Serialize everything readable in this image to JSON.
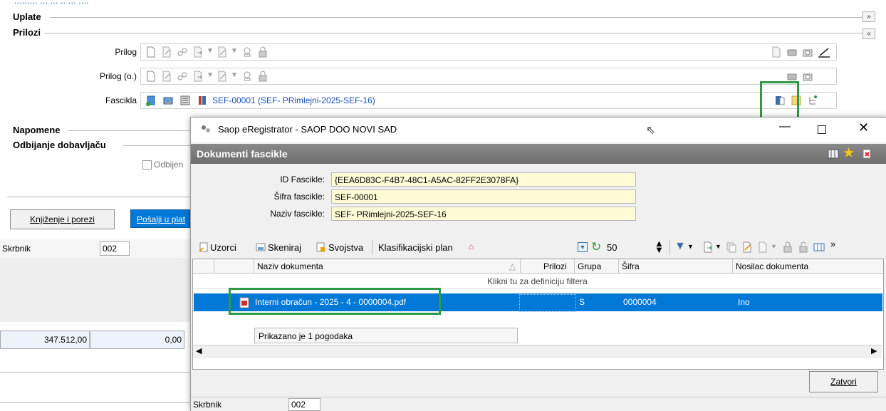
{
  "top_text": "......... ... ... .. ... ....",
  "sections": {
    "uplate": "Uplate",
    "prilozi": "Prilozi",
    "napomene": "Napomene",
    "odbijanje": "Odbijanje dobavljaču"
  },
  "rows": {
    "prilog_label": "Prilog",
    "prilog_o_label": "Prilog (o.)",
    "fascikla_label": "Fascikla",
    "fascikla_link": "SEF-00001 (SEF- PRimlejni-2025-SEF-16)"
  },
  "odbijen_label": "Odbijen",
  "buttons": {
    "knjizenje": "Knjiženje i porezi",
    "posalji": "Pošalji u plat"
  },
  "back_skrbnik": {
    "label": "Skrbnik",
    "value": "002"
  },
  "amounts": {
    "left": "347.512,00",
    "right": "0,00"
  },
  "dialog": {
    "title": "Saop eRegistrator - SAOP DOO NOVI SAD",
    "header": "Dokumenti fascikle",
    "fields": {
      "id_label": "ID Fascikle:",
      "id_value": "{EEA6D83C-F4B7-48C1-A5AC-82FF2E3078FA}",
      "sifra_label": "Šifra fascikle:",
      "sifra_value": "SEF-00001",
      "naziv_label": "Naziv fascikle:",
      "naziv_value": "SEF- PRimlejni-2025-SEF-16"
    },
    "toolbar": {
      "uzorci": "Uzorci",
      "skeniraj": "Skeniraj",
      "svojstva": "Svojstva",
      "klasifikacijski": "Klasifikacijski plan",
      "count": "50"
    },
    "grid": {
      "columns": [
        "Naziv dokumenta",
        "Prilozi",
        "Grupa",
        "Šifra",
        "Nosilac dokumenta"
      ],
      "filter_hint": "Klikni tu za definiciju filtera",
      "row": {
        "naziv": "Interni obračun - 2025 - 4 - 0000004.pdf",
        "grupa": "S",
        "sifra": "0000004",
        "nosilac": "Ino"
      },
      "footer": "Prikazano je  1 pogodaka"
    },
    "close_button": "Zatvori",
    "status": {
      "label": "Skrbnik",
      "value": "002"
    }
  },
  "colors": {
    "accent_green": "#2e9a48",
    "selection": "#0078d7",
    "field_bg": "#fffbd6"
  }
}
